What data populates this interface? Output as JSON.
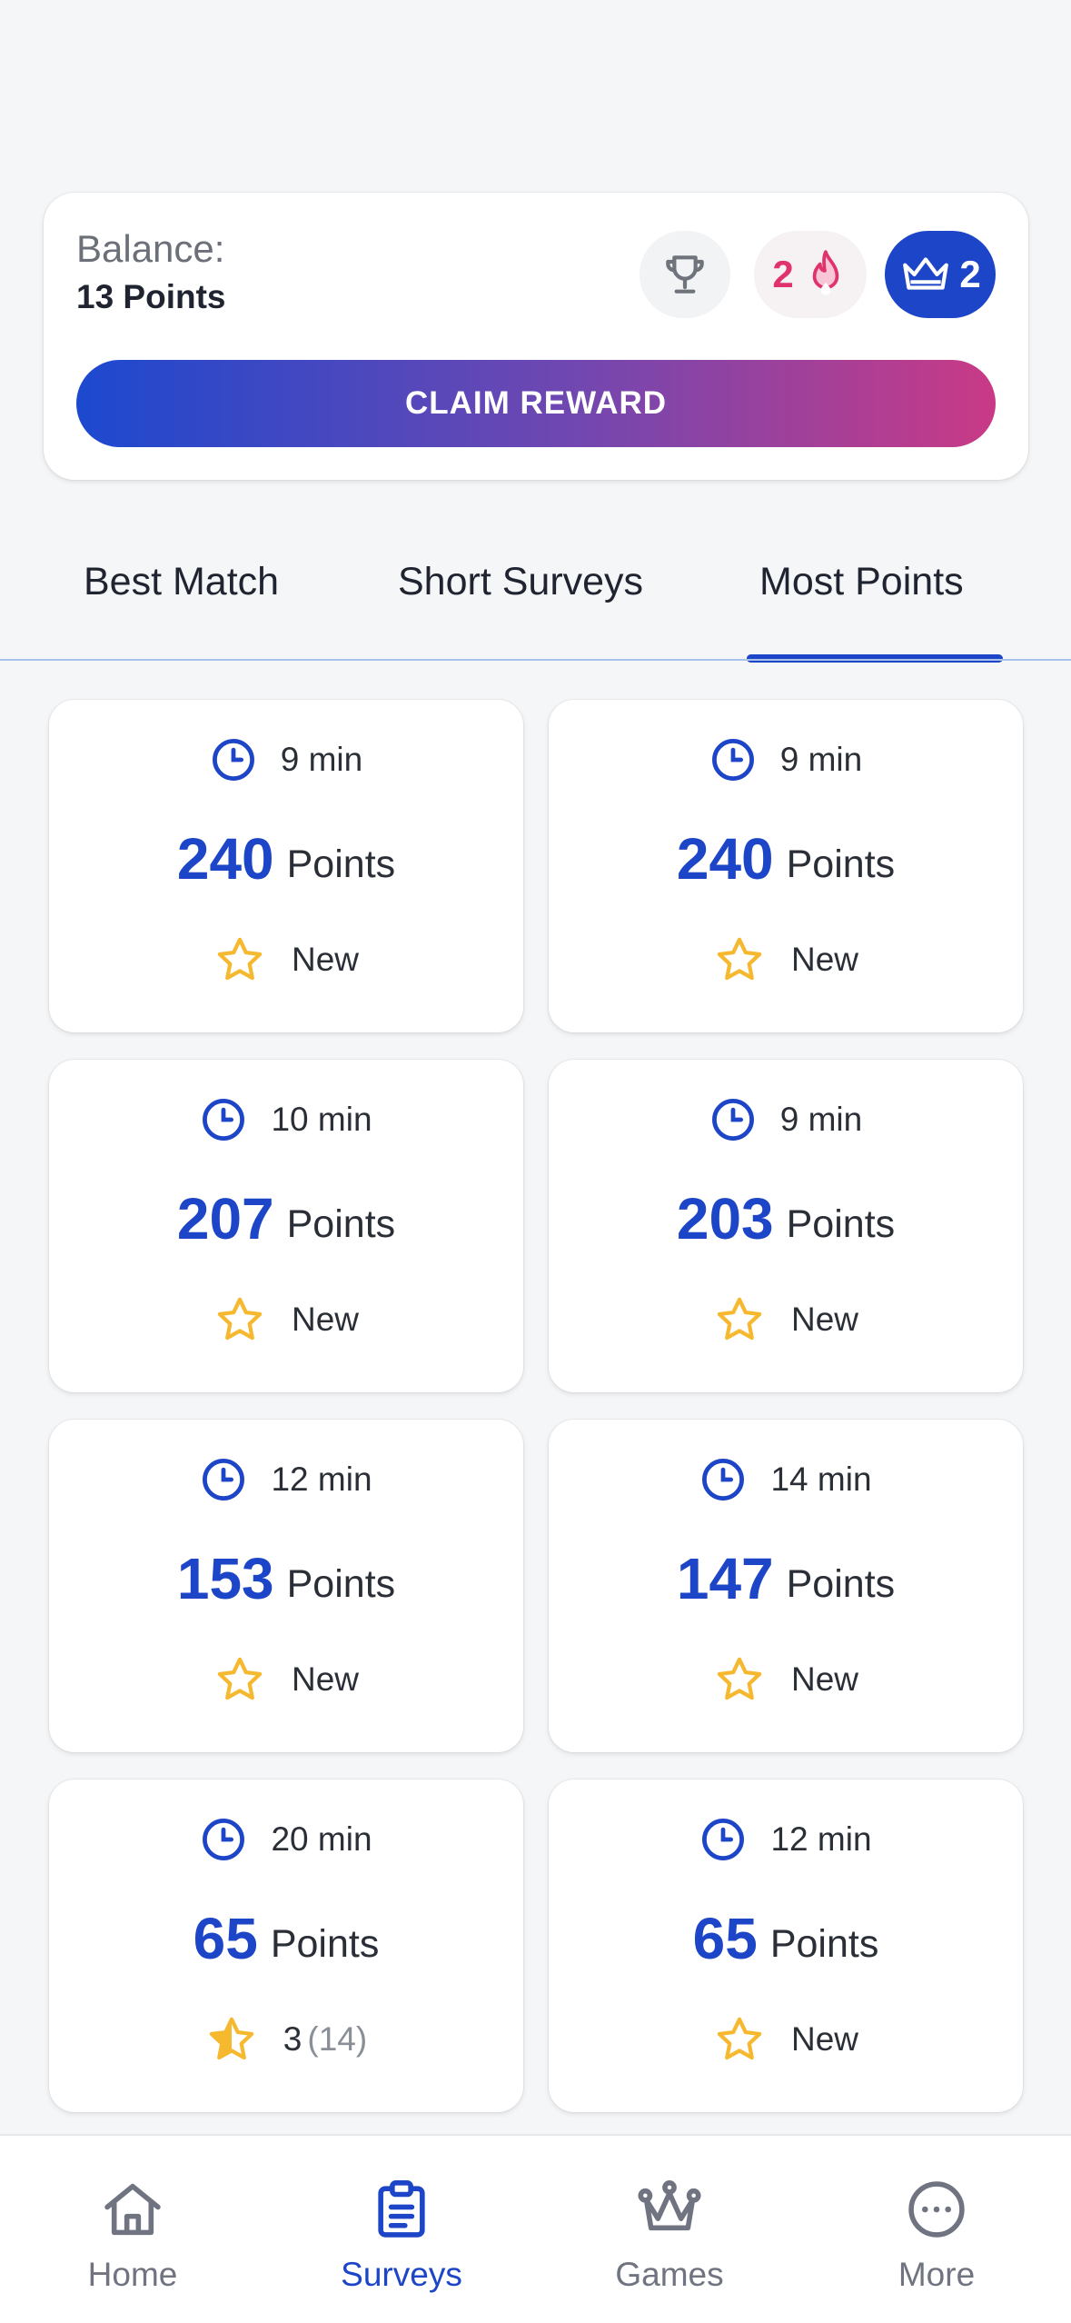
{
  "balance": {
    "label": "Balance:",
    "value": "13 Points",
    "streak_count": "2",
    "crown_count": "2",
    "claim_label": "CLAIM REWARD"
  },
  "tabs": [
    {
      "label": "Best Match"
    },
    {
      "label": "Short Surveys"
    },
    {
      "label": "Most Points",
      "active": true
    }
  ],
  "surveys": [
    {
      "time": "9 min",
      "points": "240",
      "points_label": "Points",
      "status": "New"
    },
    {
      "time": "9 min",
      "points": "240",
      "points_label": "Points",
      "status": "New"
    },
    {
      "time": "10 min",
      "points": "207",
      "points_label": "Points",
      "status": "New"
    },
    {
      "time": "9 min",
      "points": "203",
      "points_label": "Points",
      "status": "New"
    },
    {
      "time": "12 min",
      "points": "153",
      "points_label": "Points",
      "status": "New"
    },
    {
      "time": "14 min",
      "points": "147",
      "points_label": "Points",
      "status": "New"
    },
    {
      "time": "20 min",
      "points": "65",
      "points_label": "Points",
      "rating": "3",
      "rating_count": "(14)"
    },
    {
      "time": "12 min",
      "points": "65",
      "points_label": "Points",
      "status": "New"
    }
  ],
  "nav": [
    {
      "label": "Home",
      "icon": "home-icon"
    },
    {
      "label": "Surveys",
      "icon": "clipboard-icon",
      "active": true
    },
    {
      "label": "Games",
      "icon": "crown-icon"
    },
    {
      "label": "More",
      "icon": "more-icon"
    }
  ],
  "colors": {
    "accent": "#1d45c7",
    "streak": "#e0336b",
    "star": "#f5b82e",
    "gradient_start": "#1c49cf",
    "gradient_end": "#c93a86"
  }
}
